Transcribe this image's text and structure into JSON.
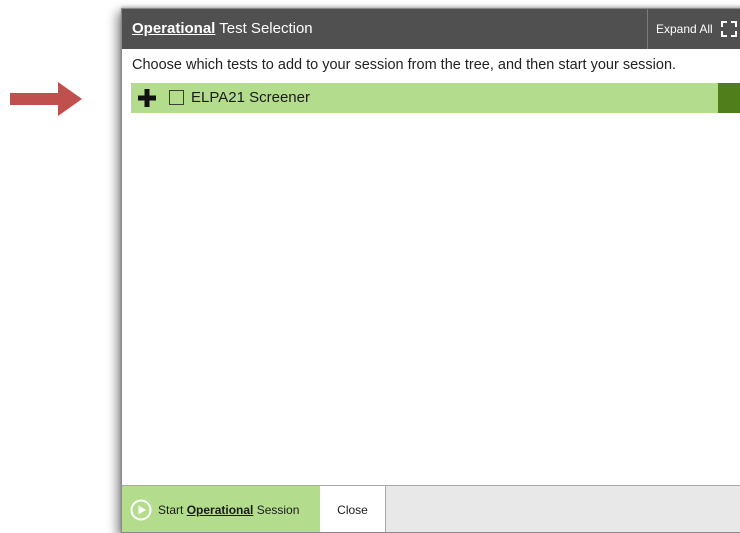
{
  "dialog": {
    "title_emphasis": "Operational",
    "title_rest": " Test Selection",
    "expand_all_label": "Expand All",
    "instructions": "Choose which tests to add to your session from the tree, and then start your session."
  },
  "tree": {
    "items": [
      {
        "label": "ELPA21 Screener",
        "checked": false,
        "expanded": false
      }
    ]
  },
  "footer": {
    "start_prefix": "Start ",
    "start_emphasis": "Operational",
    "start_suffix": " Session",
    "close_label": "Close"
  },
  "colors": {
    "titlebar": "#505050",
    "row_highlight": "#b3dd8c",
    "row_accent": "#4f7e1a",
    "arrow": "#c0504d"
  },
  "icons": {
    "arrow": "right-arrow-icon",
    "expand_all": "expand-icon",
    "tree_toggle": "plus-icon",
    "start": "play-circle-icon"
  }
}
